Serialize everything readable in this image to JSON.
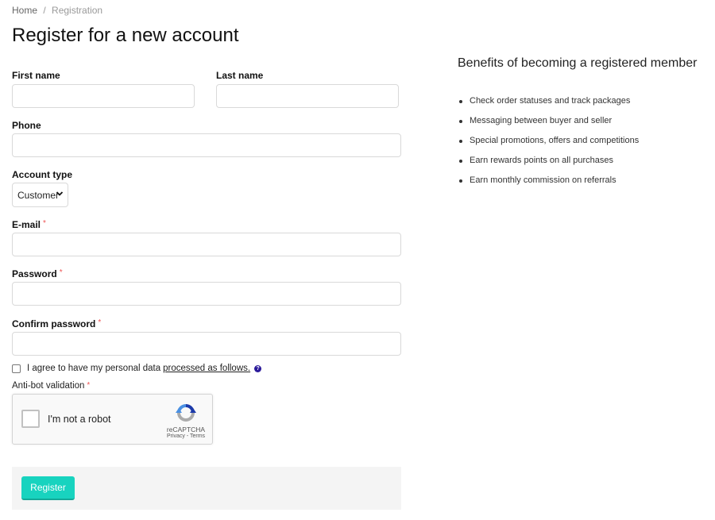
{
  "breadcrumb": {
    "home": "Home",
    "separator": "/",
    "current": "Registration"
  },
  "page_title": "Register for a new account",
  "form": {
    "first_name": {
      "label": "First name",
      "value": "",
      "placeholder": ""
    },
    "last_name": {
      "label": "Last name",
      "value": "",
      "placeholder": ""
    },
    "phone": {
      "label": "Phone",
      "value": "",
      "placeholder": ""
    },
    "account_type": {
      "label": "Account type",
      "selected": "Customer"
    },
    "email": {
      "label": "E-mail",
      "required_mark": "*",
      "value": "",
      "placeholder": ""
    },
    "password": {
      "label": "Password",
      "required_mark": "*",
      "value": "",
      "placeholder": ""
    },
    "confirm_password": {
      "label": "Confirm password",
      "required_mark": "*",
      "value": "",
      "placeholder": ""
    },
    "agree": {
      "checked": false,
      "text": "I agree to have my personal data",
      "link_text": "processed as follows.",
      "help_icon": "?"
    },
    "antibot": {
      "label": "Anti-bot validation",
      "required_mark": "*",
      "checkbox_text": "I'm not a robot",
      "brand": "reCAPTCHA",
      "links": "Privacy - Terms"
    },
    "submit_label": "Register"
  },
  "benefits": {
    "title": "Benefits of becoming a registered member",
    "items": [
      "Check order statuses and track packages",
      "Messaging between buyer and seller",
      "Special promotions, offers and competitions",
      "Earn rewards points on all purchases",
      "Earn monthly commission on referrals"
    ]
  },
  "colors": {
    "accent": "#18d3bf",
    "required": "#e55555",
    "help_icon": "#2b1a9a"
  }
}
